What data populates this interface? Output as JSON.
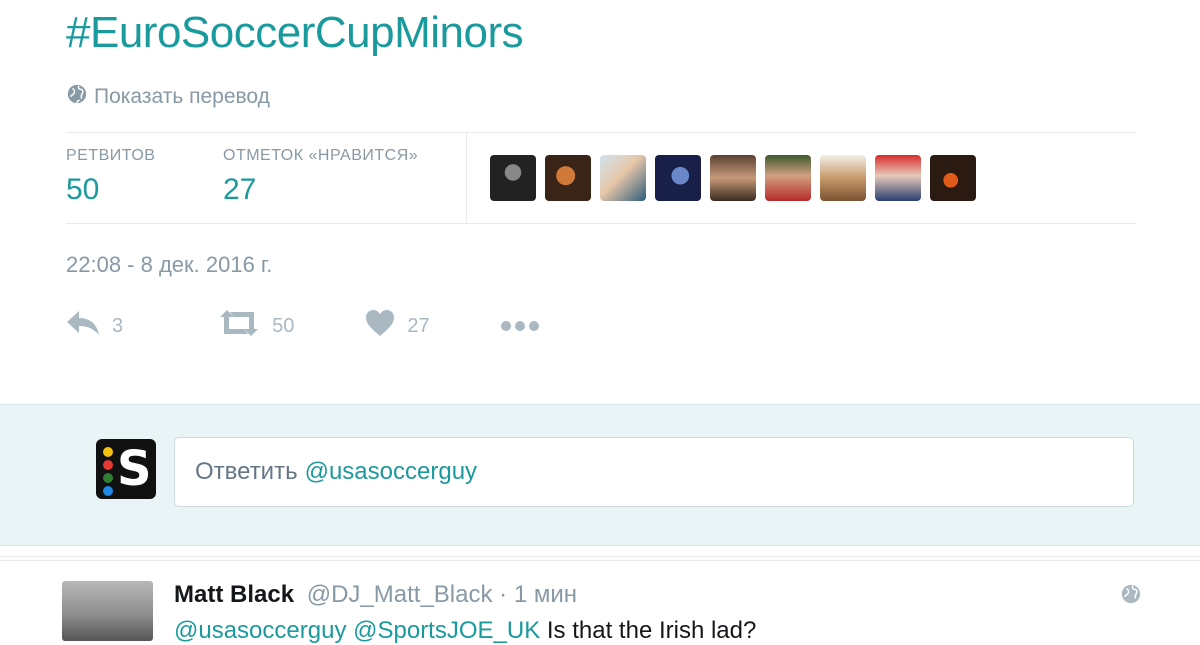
{
  "tweet": {
    "hashtag": "#EuroSoccerCupMinors",
    "translate_label": "Показать перевод",
    "stats": {
      "retweets_label": "РЕТВИТОВ",
      "retweets_value": "50",
      "likes_label": "ОТМЕТОК «НРАВИТСЯ»",
      "likes_value": "27"
    },
    "timestamp": "22:08 - 8 дек. 2016 г.",
    "actions": {
      "reply_count": "3",
      "retweet_count": "50",
      "like_count": "27"
    }
  },
  "reply": {
    "placeholder_prefix": "Ответить",
    "placeholder_mention": "@usasoccerguy"
  },
  "reply_tweet": {
    "name": "Matt Black",
    "handle": "@DJ_Matt_Black",
    "separator": "·",
    "time": "1 мин",
    "mention1": "@usasoccerguy",
    "mention2": "@SportsJOE_UK",
    "text": "Is that the Irish lad?"
  },
  "colors": {
    "accent": "#1b9a9e",
    "muted": "#8899a6",
    "reply_bg": "#e8f4f6"
  },
  "icons": [
    "globe-icon",
    "reply-icon",
    "retweet-icon",
    "heart-icon",
    "more-icon",
    "app-logo-icon"
  ]
}
